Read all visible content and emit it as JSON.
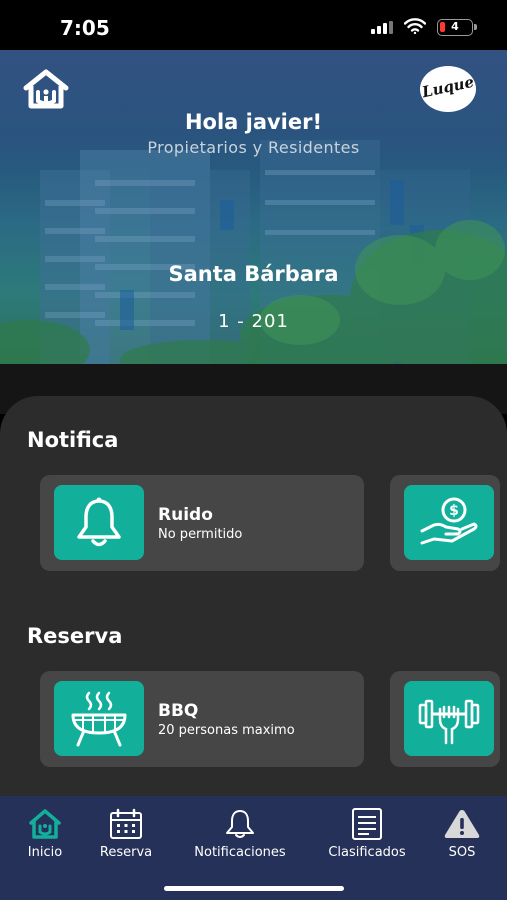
{
  "status_bar": {
    "time": "7:05",
    "battery": "4"
  },
  "header": {
    "greeting": "Hola javier!",
    "subtitle": "Propietarios y Residentes",
    "building": "Santa Bárbara",
    "unit": "1 - 201",
    "brand_logo_text": "Luque"
  },
  "sections": {
    "notifica": {
      "title": "Notifica",
      "cards": [
        {
          "title": "Ruido",
          "description": "No permitido",
          "icon": "bell-icon"
        },
        {
          "title": "",
          "description": "",
          "icon": "money-hand-icon"
        }
      ]
    },
    "reserva": {
      "title": "Reserva",
      "cards": [
        {
          "title": "BBQ",
          "description": "20 personas maximo",
          "icon": "grill-icon"
        },
        {
          "title": "",
          "description": "",
          "icon": "dumbbell-icon"
        }
      ]
    }
  },
  "nav": {
    "items": [
      {
        "label": "Inicio",
        "icon": "home-icon",
        "active": true
      },
      {
        "label": "Reserva",
        "icon": "calendar-icon",
        "active": false
      },
      {
        "label": "Notificaciones",
        "icon": "bell-icon",
        "active": false
      },
      {
        "label": "Clasificados",
        "icon": "document-icon",
        "active": false
      },
      {
        "label": "SOS",
        "icon": "warning-icon",
        "active": false
      }
    ]
  },
  "colors": {
    "accent": "#12b09b",
    "nav_bg": "#263159",
    "panel_bg": "#2c2c2c",
    "card_bg": "#464646",
    "active_icon": "#12b09b"
  }
}
